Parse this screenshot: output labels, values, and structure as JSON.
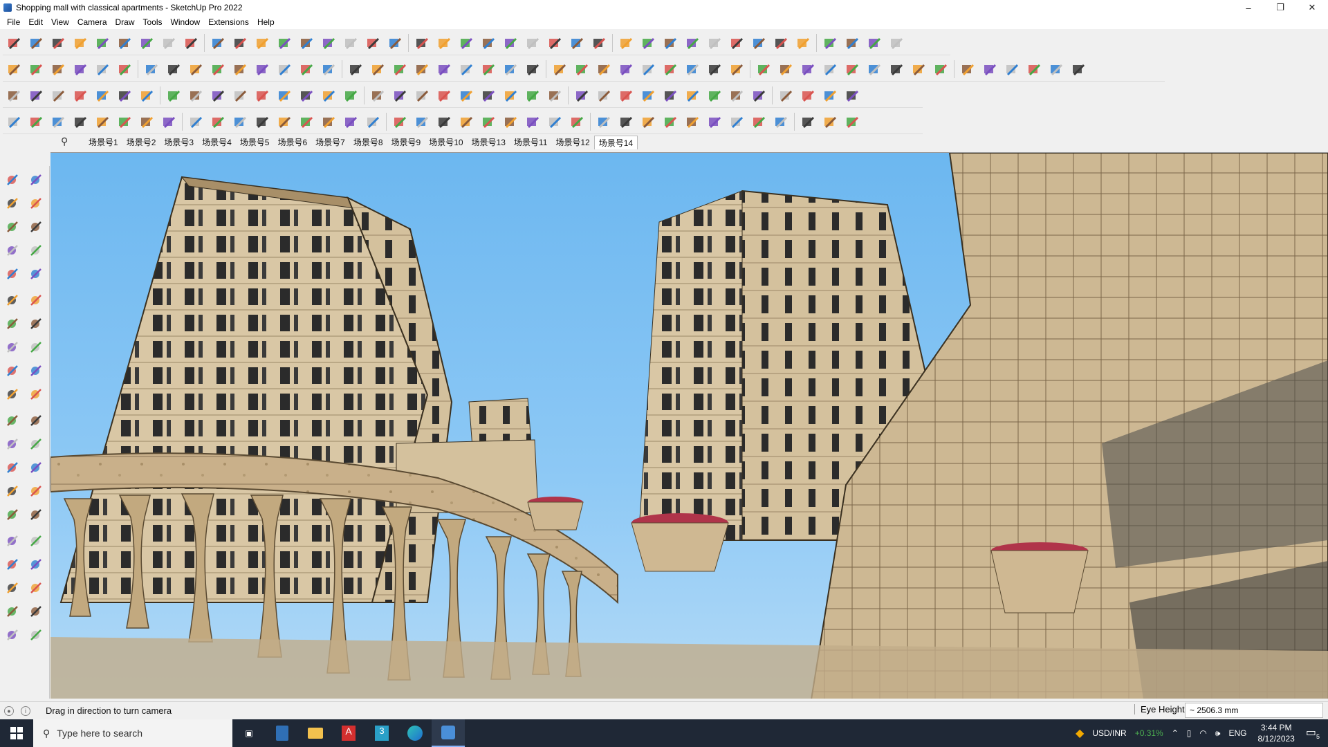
{
  "window": {
    "title": "Shopping mall with classical apartments - SketchUp Pro 2022",
    "minimize": "–",
    "maximize": "❐",
    "close": "✕"
  },
  "menu": [
    "File",
    "Edit",
    "View",
    "Camera",
    "Draw",
    "Tools",
    "Window",
    "Extensions",
    "Help"
  ],
  "scenes": {
    "search_icon": "⚲",
    "tabs": [
      "场景号1",
      "场景号2",
      "场景号3",
      "场景号4",
      "场景号5",
      "场景号6",
      "场景号7",
      "场景号8",
      "场景号9",
      "场景号10",
      "场景号13",
      "场景号11",
      "场景号12",
      "场景号14"
    ],
    "active": "场景号14"
  },
  "status": {
    "message": "Drag in direction to turn camera",
    "vcb_label": "Eye Height",
    "vcb_value": "~ 2506.3 mm"
  },
  "taskbar": {
    "search_placeholder": "Type here to search",
    "currency": "USD/INR",
    "currency_change": "+0.31%",
    "language": "ENG",
    "time": "3:44 PM",
    "date": "8/12/2023",
    "notification_count": "5"
  },
  "colors": {
    "sky": "#6cb7f0",
    "building": "#d9c7a5",
    "building_shade": "#b8a07a",
    "window": "#2b2b2b",
    "taskbar": "#1f2836",
    "currency_up": "#4caf50"
  }
}
